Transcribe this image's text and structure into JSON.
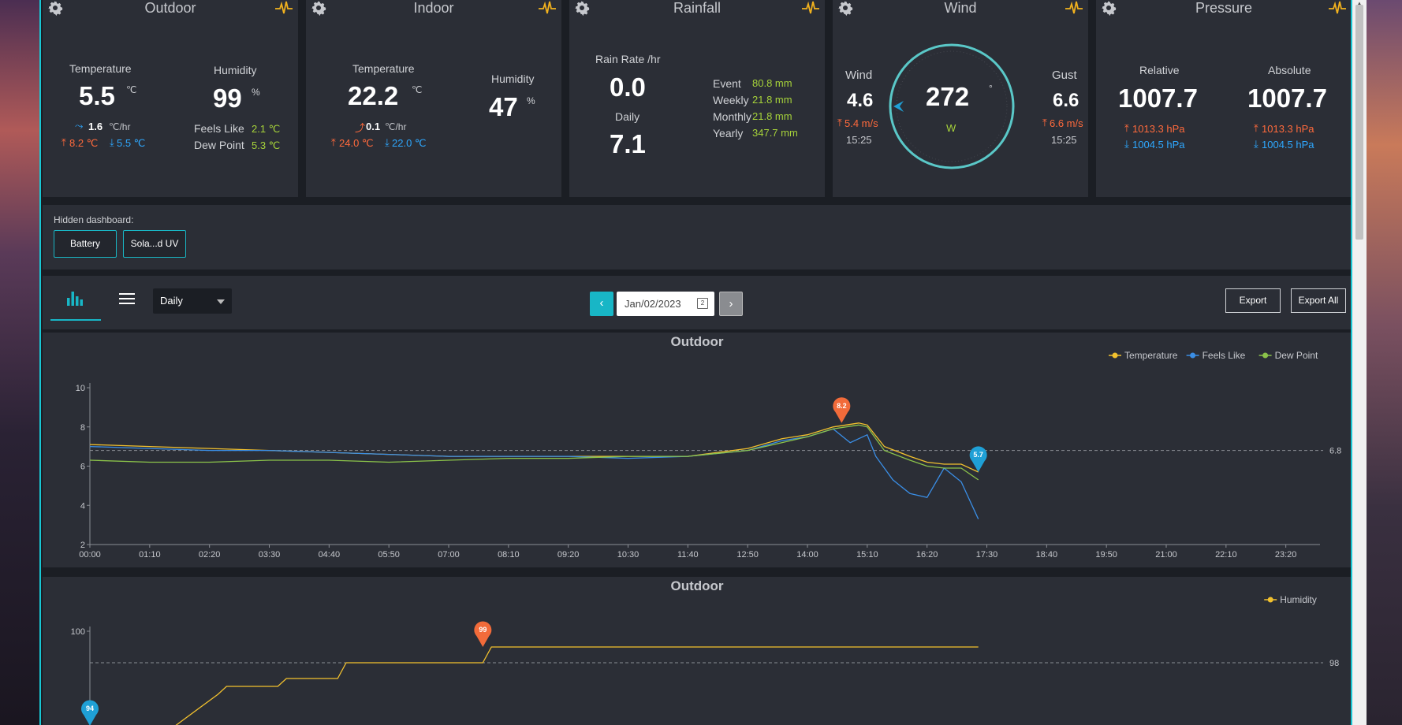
{
  "cards": {
    "outdoor": {
      "title": "Outdoor",
      "temp_label": "Temperature",
      "temp": "5.5",
      "temp_unit": "℃",
      "trend": "1.6",
      "trend_unit": "℃/hr",
      "temp_high": "8.2 ℃",
      "temp_low": "5.5 ℃",
      "hum_label": "Humidity",
      "hum": "99",
      "hum_unit": "%",
      "feels_label": "Feels Like",
      "feels": "2.1 ℃",
      "dew_label": "Dew Point",
      "dew": "5.3 ℃"
    },
    "indoor": {
      "title": "Indoor",
      "temp_label": "Temperature",
      "temp": "22.2",
      "temp_unit": "℃",
      "trend": "0.1",
      "trend_unit": "℃/hr",
      "temp_high": "24.0 ℃",
      "temp_low": "22.0 ℃",
      "hum_label": "Humidity",
      "hum": "47",
      "hum_unit": "%"
    },
    "rainfall": {
      "title": "Rainfall",
      "rate_label": "Rain Rate /hr",
      "rate": "0.0",
      "daily_label": "Daily",
      "daily": "7.1",
      "rows": [
        {
          "label": "Event",
          "value": "80.8 mm"
        },
        {
          "label": "Weekly",
          "value": "21.8 mm"
        },
        {
          "label": "Monthly",
          "value": "21.8 mm"
        },
        {
          "label": "Yearly",
          "value": "347.7 mm"
        }
      ]
    },
    "wind": {
      "title": "Wind",
      "wind_label": "Wind",
      "wind": "4.6",
      "wind_max": "5.4 m/s",
      "wind_time": "15:25",
      "dir": "272",
      "dir_unit": "°",
      "dir_letter": "W",
      "gust_label": "Gust",
      "gust": "6.6",
      "gust_max": "6.6 m/s",
      "gust_time": "15:25"
    },
    "pressure": {
      "title": "Pressure",
      "rel_label": "Relative",
      "rel": "1007.7",
      "rel_high": "1013.3 hPa",
      "rel_low": "1004.5 hPa",
      "abs_label": "Absolute",
      "abs": "1007.7",
      "abs_high": "1013.3 hPa",
      "abs_low": "1004.5 hPa"
    }
  },
  "hidden_dashboard": {
    "caption": "Hidden dashboard:",
    "buttons": [
      "Battery",
      "Sola...d UV"
    ]
  },
  "toolbar": {
    "range": "Daily",
    "date": "Jan/02/2023",
    "calendar_day": "2",
    "prev": "‹",
    "next": "›",
    "export": "Export",
    "export_all": "Export All"
  },
  "colors": {
    "accent": "#18b6c6",
    "temperature": "#f2c12e",
    "feels_like": "#3a8ee6",
    "dew_point": "#8bc34a",
    "high": "#ff6a3c",
    "low": "#2ea8ff"
  },
  "chart_data": [
    {
      "type": "line",
      "title": "Outdoor",
      "ylim": [
        2,
        10
      ],
      "yticks": [
        "2",
        "4",
        "6",
        "8",
        "10"
      ],
      "x_ticks": [
        "00:00",
        "01:10",
        "02:20",
        "03:30",
        "04:40",
        "05:50",
        "07:00",
        "08:10",
        "09:20",
        "10:30",
        "11:40",
        "12:50",
        "14:00",
        "15:10",
        "16:20",
        "17:30",
        "18:40",
        "19:50",
        "21:00",
        "22:10",
        "23:20"
      ],
      "legend_position": "top-right",
      "average_line": {
        "value": 6.8,
        "label": "6.8"
      },
      "max_marker": {
        "x": "14:40",
        "value": 8.2,
        "label": "8.2"
      },
      "last_marker": {
        "x": "17:20",
        "value": 5.7,
        "label": "5.7"
      },
      "series": [
        {
          "name": "Temperature",
          "color": "#f2c12e",
          "x": [
            "00:00",
            "01:10",
            "02:20",
            "03:30",
            "04:40",
            "05:50",
            "07:00",
            "08:10",
            "09:20",
            "10:30",
            "11:40",
            "12:50",
            "13:30",
            "14:00",
            "14:30",
            "15:00",
            "15:10",
            "15:30",
            "16:00",
            "16:20",
            "16:40",
            "17:00",
            "17:20"
          ],
          "values": [
            7.1,
            7.0,
            6.9,
            6.8,
            6.7,
            6.6,
            6.5,
            6.5,
            6.5,
            6.5,
            6.5,
            6.9,
            7.4,
            7.6,
            8.0,
            8.2,
            8.1,
            7.0,
            6.5,
            6.2,
            6.1,
            6.1,
            5.7
          ]
        },
        {
          "name": "Feels Like",
          "color": "#3a8ee6",
          "x": [
            "00:00",
            "01:10",
            "02:20",
            "03:30",
            "04:40",
            "05:50",
            "07:00",
            "08:10",
            "09:20",
            "10:30",
            "11:40",
            "12:50",
            "13:30",
            "14:00",
            "14:30",
            "14:50",
            "15:10",
            "15:20",
            "15:40",
            "16:00",
            "16:20",
            "16:40",
            "17:00",
            "17:20"
          ],
          "values": [
            7.0,
            6.9,
            6.8,
            6.8,
            6.7,
            6.6,
            6.5,
            6.5,
            6.5,
            6.4,
            6.5,
            6.8,
            7.3,
            7.5,
            7.9,
            7.2,
            7.6,
            6.5,
            5.3,
            4.6,
            4.4,
            5.9,
            5.2,
            3.3
          ]
        },
        {
          "name": "Dew Point",
          "color": "#8bc34a",
          "x": [
            "00:00",
            "01:10",
            "02:20",
            "03:30",
            "04:40",
            "05:50",
            "07:00",
            "08:10",
            "09:20",
            "10:30",
            "11:40",
            "12:50",
            "13:30",
            "14:00",
            "14:30",
            "15:00",
            "15:10",
            "15:30",
            "16:00",
            "16:20",
            "16:40",
            "17:00",
            "17:20"
          ],
          "values": [
            6.3,
            6.2,
            6.2,
            6.3,
            6.3,
            6.2,
            6.3,
            6.4,
            6.4,
            6.5,
            6.5,
            6.8,
            7.2,
            7.5,
            7.9,
            8.1,
            8.0,
            6.8,
            6.3,
            6.0,
            5.9,
            5.9,
            5.3
          ]
        }
      ]
    },
    {
      "type": "line",
      "title": "Outdoor",
      "ylim": [
        94,
        100
      ],
      "yticks": [
        "100"
      ],
      "legend_position": "top-right",
      "average_line": {
        "value": 98,
        "label": "98"
      },
      "max_marker": {
        "x": "07:40",
        "value": 99,
        "label": "99"
      },
      "min_marker": {
        "x": "00:00",
        "value": 94,
        "label": "94"
      },
      "series": [
        {
          "name": "Humidity",
          "color": "#f2c12e",
          "x": [
            "00:00",
            "01:40",
            "02:30",
            "02:40",
            "03:40",
            "03:50",
            "04:50",
            "05:00",
            "07:40",
            "07:50",
            "17:20"
          ],
          "values": [
            94,
            94,
            96,
            96.5,
            96.5,
            97,
            97,
            98,
            98,
            99,
            99
          ]
        }
      ]
    }
  ]
}
